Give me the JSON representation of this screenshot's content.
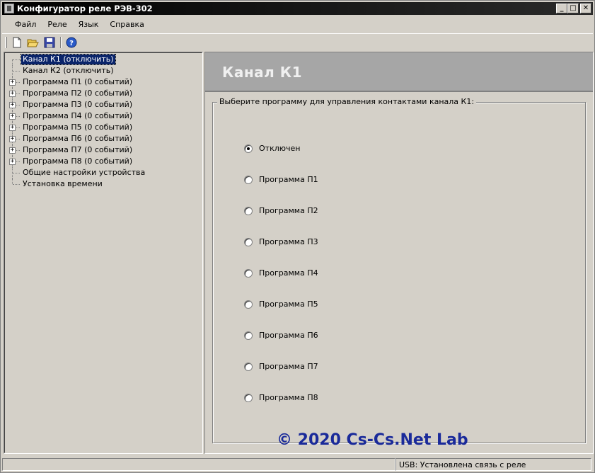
{
  "window": {
    "title": "Конфигуратор реле РЭВ-302"
  },
  "menu": [
    {
      "label": "Файл"
    },
    {
      "label": "Реле"
    },
    {
      "label": "Язык"
    },
    {
      "label": "Справка"
    }
  ],
  "toolbar": [
    "new-icon",
    "open-icon",
    "save-icon",
    "help-icon"
  ],
  "tree": [
    {
      "label": "Канал К1 (отключить)",
      "selected": true,
      "expandable": false
    },
    {
      "label": "Канал К2 (отключить)",
      "expandable": false
    },
    {
      "label": "Программа П1 (0 событий)",
      "expandable": true
    },
    {
      "label": "Программа П2 (0 событий)",
      "expandable": true
    },
    {
      "label": "Программа П3 (0 событий)",
      "expandable": true
    },
    {
      "label": "Программа П4 (0 событий)",
      "expandable": true
    },
    {
      "label": "Программа П5 (0 событий)",
      "expandable": true
    },
    {
      "label": "Программа П6 (0 событий)",
      "expandable": true
    },
    {
      "label": "Программа П7 (0 событий)",
      "expandable": true
    },
    {
      "label": "Программа П8 (0 событий)",
      "expandable": true
    },
    {
      "label": "Общие настройки устройства",
      "expandable": false
    },
    {
      "label": "Установка времени",
      "expandable": false
    }
  ],
  "panel": {
    "title": "Канал К1",
    "group_caption": "Выберите программу для управления контактами канала К1:",
    "options": [
      {
        "label": "Отключен",
        "checked": true
      },
      {
        "label": "Программа П1",
        "checked": false
      },
      {
        "label": "Программа П2",
        "checked": false
      },
      {
        "label": "Программа П3",
        "checked": false
      },
      {
        "label": "Программа П4",
        "checked": false
      },
      {
        "label": "Программа П5",
        "checked": false
      },
      {
        "label": "Программа П6",
        "checked": false
      },
      {
        "label": "Программа П7",
        "checked": false
      },
      {
        "label": "Программа П8",
        "checked": false
      }
    ]
  },
  "copyright": "© 2020 Cs-Cs.Net Lab",
  "status": {
    "connection": "USB: Установлена связь с реле"
  },
  "colors": {
    "selection": "#0a246a",
    "header_band": "#a6a6a6",
    "copyright": "#1a2a9a"
  }
}
